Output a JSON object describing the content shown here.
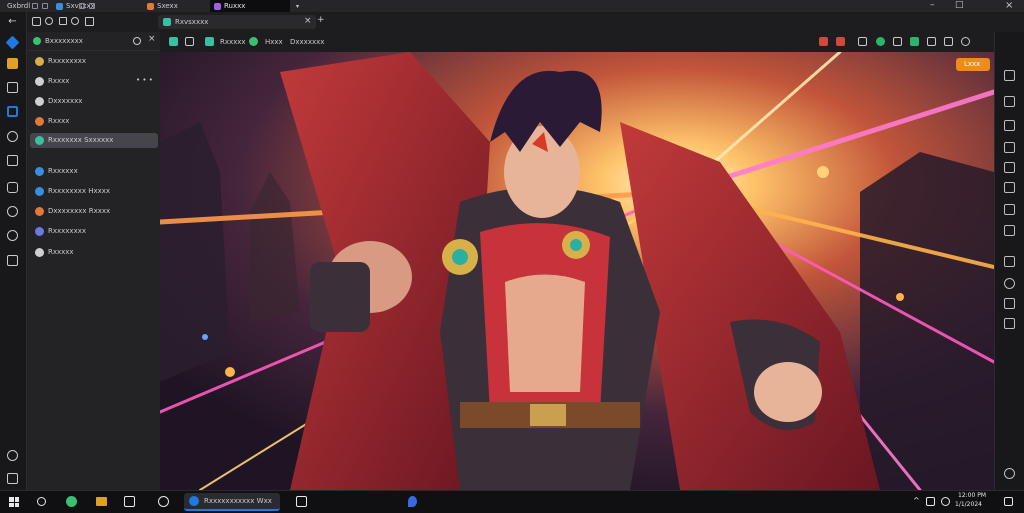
{
  "tabs": [
    {
      "label": "Gxbrdl"
    },
    {
      "label": "Sxvsxxx"
    },
    {
      "label": "Sxexx"
    },
    {
      "label": "Ruxxx"
    },
    {
      "label": "Roxxxxx"
    }
  ],
  "vertical_tabs": {
    "title": "Rxvsxxxx",
    "close": "×",
    "add": "+"
  },
  "window_controls": {
    "minimize": "–",
    "maximize": "□",
    "close": "×"
  },
  "sidebar": {
    "header": "Bxxxxxxxx",
    "items": [
      {
        "label": "Rxxxxxxxx",
        "color": "#d8b04a"
      },
      {
        "label": "Rxxxx",
        "color": "#cfcfd4"
      },
      {
        "label": "Dxxxxxxx",
        "color": "#cfcfd4"
      },
      {
        "label": "Rxxxx",
        "color": "#e07a3a"
      },
      {
        "label": "Rxxxxxxx Sxxxxxx",
        "color": "#3ac0a0",
        "selected": true
      },
      {
        "label": "Rxxxxxx",
        "color": "#3a8ee0"
      },
      {
        "label": "Rxxxxxxxx Hxxxx",
        "color": "#3a8ee0"
      },
      {
        "label": "Dxxxxxxxx Rxxxx",
        "color": "#e07a3a"
      },
      {
        "label": "Rxxxxxxxx",
        "color": "#6a7ae0"
      },
      {
        "label": "Rxxxxx",
        "color": "#cfcfd4"
      }
    ]
  },
  "address_bar": {
    "breadcrumbs": [
      "Rxxxxx",
      "Hxxx",
      "Dxxxxxxx"
    ]
  },
  "badge": {
    "label": "Lxxx",
    "color": "#f08a1c"
  },
  "taskbar": {
    "app_label": "Rxxxxxxxxxxx Wxx",
    "clock_time": "12:00 PM",
    "clock_date": "1/1/2024"
  },
  "colors": {
    "accent": "#1e7ae0",
    "selected_bg": "#45454b"
  }
}
